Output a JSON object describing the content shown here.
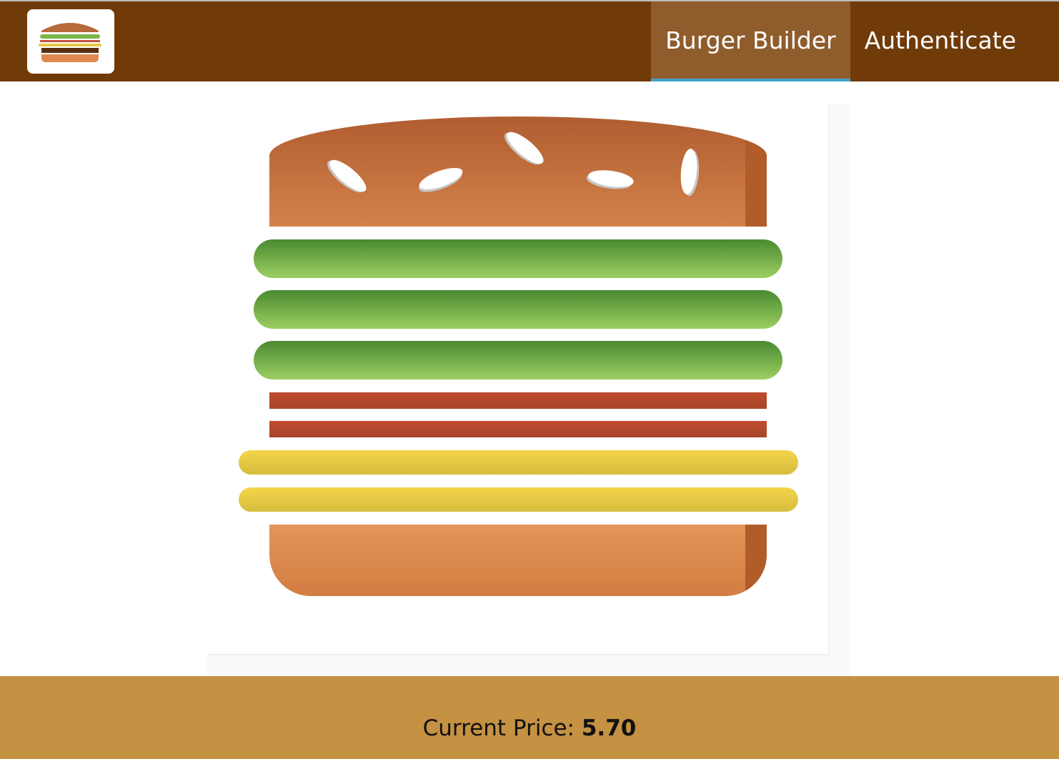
{
  "toolbar": {
    "logo_icon": "burger-logo-icon",
    "nav": [
      {
        "label": "Burger Builder",
        "active": true
      },
      {
        "label": "Authenticate",
        "active": false
      }
    ]
  },
  "burger": {
    "ingredients": [
      "bread-top",
      "salad",
      "salad",
      "salad",
      "bacon",
      "bacon",
      "cheese",
      "cheese",
      "bread-bottom"
    ]
  },
  "build_controls": {
    "price_label": "Current Price:",
    "price_value": "5.70"
  },
  "colors": {
    "toolbar": "#703B09",
    "active_nav": "#8F5C2C",
    "active_indicator": "#40A4C8",
    "controls_bg": "#C59142"
  }
}
